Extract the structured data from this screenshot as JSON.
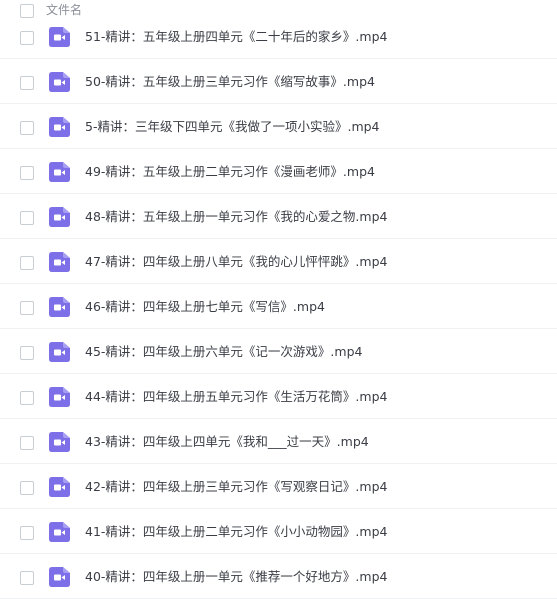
{
  "header": {
    "column_name": "文件名"
  },
  "colors": {
    "video_icon": "#7c6fe8",
    "text": "#3a3d45",
    "header_text": "#8a8f99"
  },
  "files": [
    {
      "name": "51-精讲：五年级上册四单元《二十年后的家乡》.mp4",
      "icon": "video-file-icon"
    },
    {
      "name": "50-精讲：五年级上册三单元习作《缩写故事》.mp4",
      "icon": "video-file-icon"
    },
    {
      "name": "5-精讲：三年级下四单元《我做了一项小实验》.mp4",
      "icon": "video-file-icon"
    },
    {
      "name": "49-精讲：五年级上册二单元习作《漫画老师》.mp4",
      "icon": "video-file-icon"
    },
    {
      "name": "48-精讲：五年级上册一单元习作《我的心爱之物.mp4",
      "icon": "video-file-icon"
    },
    {
      "name": "47-精讲：四年级上册八单元《我的心儿怦怦跳》.mp4",
      "icon": "video-file-icon"
    },
    {
      "name": "46-精讲：四年级上册七单元《写信》.mp4",
      "icon": "video-file-icon"
    },
    {
      "name": "45-精讲：四年级上册六单元《记一次游戏》.mp4",
      "icon": "video-file-icon"
    },
    {
      "name": "44-精讲：四年级上册五单元习作《生活万花筒》.mp4",
      "icon": "video-file-icon"
    },
    {
      "name": "43-精讲：四年级上四单元《我和___过一天》.mp4",
      "icon": "video-file-icon"
    },
    {
      "name": "42-精讲：四年级上册三单元习作《写观察日记》.mp4",
      "icon": "video-file-icon"
    },
    {
      "name": "41-精讲：四年级上册二单元习作《小小动物园》.mp4",
      "icon": "video-file-icon"
    },
    {
      "name": "40-精讲：四年级上册一单元《推荐一个好地方》.mp4",
      "icon": "video-file-icon"
    }
  ]
}
